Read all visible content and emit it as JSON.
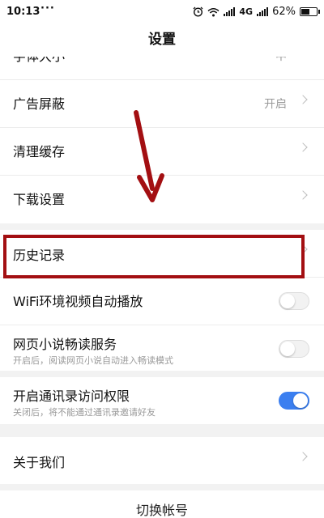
{
  "status_bar": {
    "time": "10:13",
    "dots": "···",
    "network": "4G",
    "battery": "62%",
    "battery_level": 0.62,
    "icons": [
      "alarm-icon",
      "wifi-icon",
      "signal-icon",
      "battery-icon"
    ]
  },
  "header": {
    "title": "设置"
  },
  "settings": {
    "font_size": {
      "label": "字体大小",
      "value": "中"
    },
    "ad_block": {
      "label": "广告屏蔽",
      "value": "开启"
    },
    "clear_cache": {
      "label": "清理缓存"
    },
    "download": {
      "label": "下载设置"
    },
    "history": {
      "label": "历史记录"
    },
    "wifi_autoplay": {
      "label": "WiFi环境视频自动播放",
      "enabled": false
    },
    "novel_reader": {
      "label": "网页小说畅读服务",
      "sub": "开启后，阅读网页小说自动进入畅读模式",
      "enabled": false
    },
    "contacts": {
      "label": "开启通讯录访问权限",
      "sub": "关闭后，将不能通过通讯录邀请好友",
      "enabled": true
    },
    "about": {
      "label": "关于我们"
    }
  },
  "footer": {
    "switch_account": "切换帐号"
  },
  "colors": {
    "accent": "#3b7ff0",
    "annotation": "#a30f12",
    "background": "#f2f2f2"
  },
  "annotation": {
    "arrow_icon": "red-arrow-icon"
  }
}
